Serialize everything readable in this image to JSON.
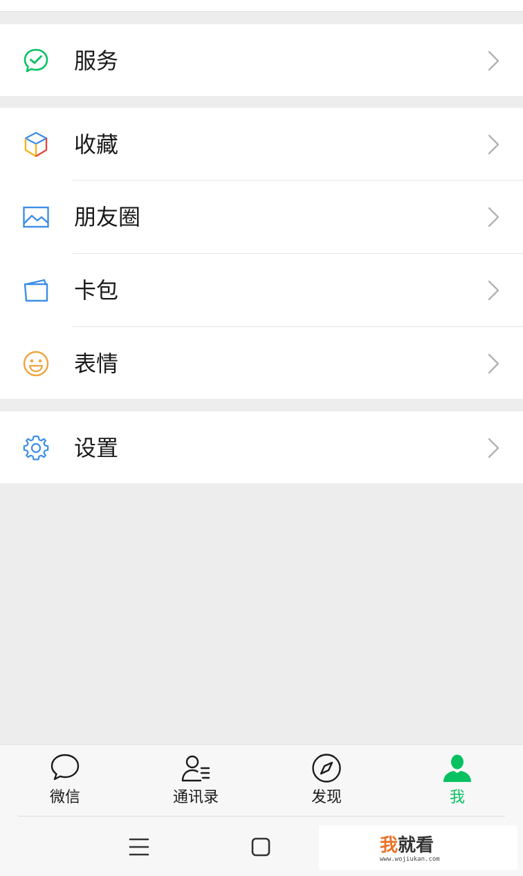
{
  "menu": {
    "services": {
      "label": "服务",
      "icon": "services-icon"
    },
    "favorites": {
      "label": "收藏",
      "icon": "favorites-box-icon"
    },
    "moments": {
      "label": "朋友圈",
      "icon": "moments-image-icon"
    },
    "card_wallet": {
      "label": "卡包",
      "icon": "card-wallet-icon"
    },
    "stickers": {
      "label": "表情",
      "icon": "sticker-smile-icon"
    },
    "settings": {
      "label": "设置",
      "icon": "gear-icon"
    }
  },
  "tabbar": {
    "tabs": [
      {
        "label": "微信",
        "icon": "chat-bubble-icon",
        "active": false
      },
      {
        "label": "通讯录",
        "icon": "contacts-icon",
        "active": false
      },
      {
        "label": "发现",
        "icon": "compass-icon",
        "active": false
      },
      {
        "label": "我",
        "icon": "person-icon",
        "active": true
      }
    ]
  },
  "system_nav": {
    "buttons": [
      "menu-icon",
      "home-icon"
    ]
  },
  "watermark": {
    "brand_a": "我",
    "brand_b": "就看",
    "url": "www.wojiukan.com"
  },
  "colors": {
    "accent_green": "#07c160",
    "background": "#ededed",
    "blue_icon": "#3d8ee6",
    "orange_icon": "#f0a33c",
    "chevron": "#b2b2b2"
  }
}
